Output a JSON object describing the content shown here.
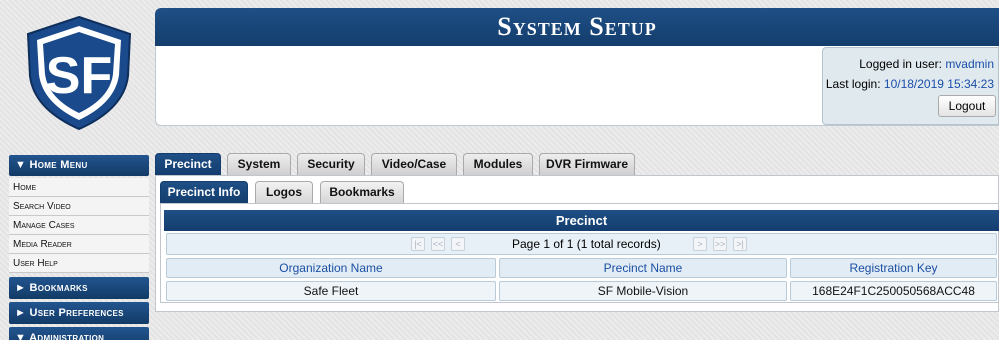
{
  "header": {
    "title": "System Setup",
    "logo_text": "SF",
    "logged_in_label": "Logged in user:",
    "logged_in_user": "mvadmin",
    "last_login_label": "Last login:",
    "last_login_value": "10/18/2019 15:34:23",
    "logout_label": "Logout"
  },
  "sidebar": {
    "home_menu": {
      "label": "▼ Home Menu",
      "items": [
        "Home",
        "Search Video",
        "Manage Cases",
        "Media Reader",
        "User Help"
      ]
    },
    "bookmarks_label": "► Bookmarks",
    "user_prefs_label": "► User Preferences",
    "admin_label": "▼ Administration"
  },
  "tabs": [
    "Precinct",
    "System",
    "Security",
    "Video/Case",
    "Modules",
    "DVR Firmware"
  ],
  "active_tab": "Precinct",
  "subtabs": [
    "Precinct Info",
    "Logos",
    "Bookmarks"
  ],
  "active_subtab": "Precinct Info",
  "grid": {
    "title": "Precinct",
    "pager_text": "Page 1 of 1 (1 total records)",
    "pager_icons": [
      "first-page-icon",
      "prev-page-icon",
      "prev-icon",
      "next-icon",
      "next-page-icon",
      "last-page-icon"
    ],
    "columns": [
      "Organization Name",
      "Precinct Name",
      "Registration Key"
    ],
    "rows": [
      [
        "Safe Fleet",
        "SF Mobile-Vision",
        "168E24F1C250050568ACC48"
      ]
    ]
  },
  "colors": {
    "brand_blue": "#1b4a80",
    "link_blue": "#1b4ea8",
    "panel_bg": "#e2ecf4"
  }
}
